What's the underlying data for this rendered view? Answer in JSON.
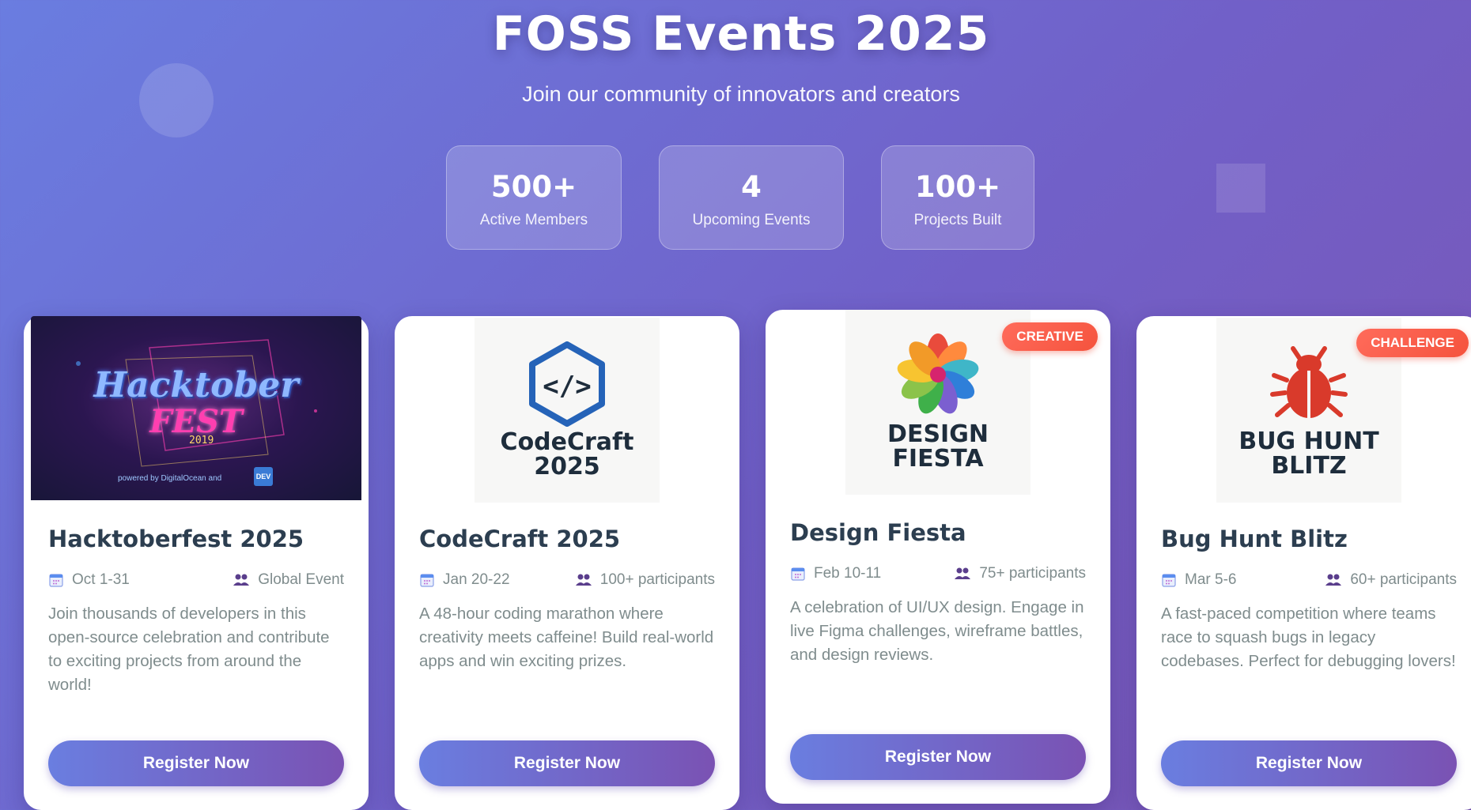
{
  "header": {
    "title": "FOSS Events 2025",
    "subtitle": "Join our community of innovators and creators"
  },
  "stats": [
    {
      "value": "500+",
      "label": "Active Members"
    },
    {
      "value": "4",
      "label": "Upcoming Events"
    },
    {
      "value": "100+",
      "label": "Projects Built"
    }
  ],
  "events": [
    {
      "title": "Hacktoberfest 2025",
      "date": "Oct 1-31",
      "participants": "Global Event",
      "description": "Join thousands of developers in this open-source celebration and contribute to exciting projects from around the world!",
      "button": "Register Now",
      "image_text": {
        "title": "Hacktober",
        "sub": "FEST",
        "year": "2019",
        "footer": "powered by DigitalOcean and",
        "dev": "DEV"
      }
    },
    {
      "title": "CodeCraft 2025",
      "date": "Jan 20-22",
      "participants": "100+ participants",
      "description": "A 48-hour coding marathon where creativity meets caffeine! Build real-world apps and win exciting prizes.",
      "button": "Register Now",
      "logo_text": "CodeCraft\n2025",
      "logo_icon": "code-hexagon-icon"
    },
    {
      "title": "Design Fiesta",
      "date": "Feb 10-11",
      "participants": "75+ participants",
      "description": "A celebration of UI/UX design. Engage in live Figma challenges, wireframe battles, and design reviews.",
      "button": "Register Now",
      "badge": "CREATIVE",
      "logo_text": "DESIGN\nFIESTA",
      "logo_icon": "flower-icon"
    },
    {
      "title": "Bug Hunt Blitz",
      "date": "Mar 5-6",
      "participants": "60+ participants",
      "description": "A fast-paced competition where teams race to squash bugs in legacy codebases. Perfect for debugging lovers!",
      "button": "Register Now",
      "badge": "CHALLENGE",
      "logo_text": "BUG HUNT\nBLITZ",
      "logo_icon": "bug-icon"
    }
  ],
  "icons": {
    "date": "calendar-icon",
    "participants": "users-icon"
  },
  "colors": {
    "accent_start": "#6a7ee0",
    "accent_end": "#7a52b3",
    "badge": "#f5533d",
    "title_text": "#2c3e50"
  }
}
